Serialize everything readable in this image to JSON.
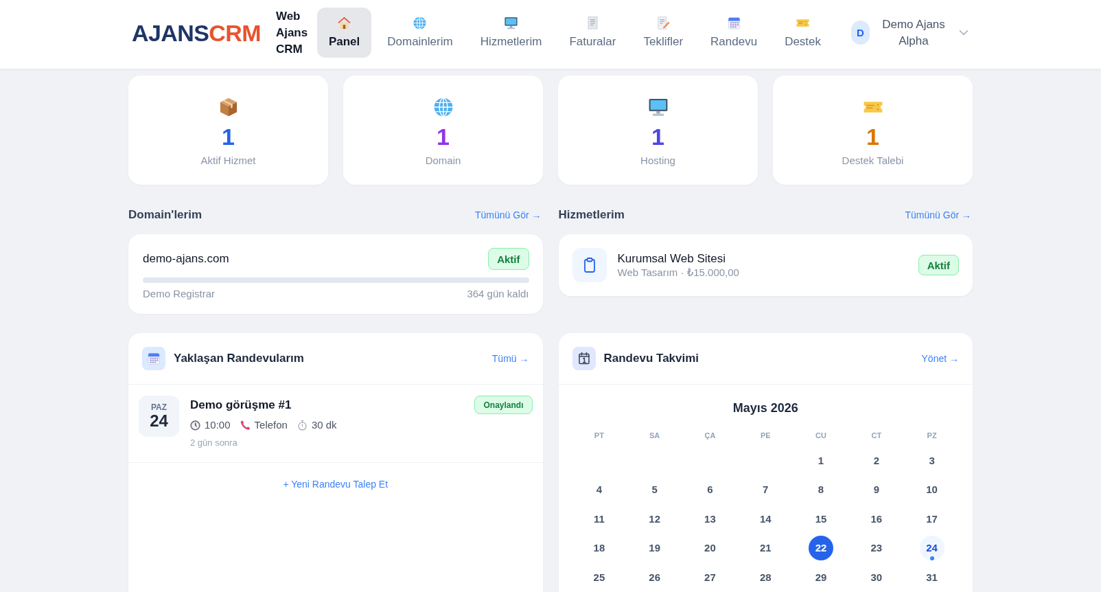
{
  "header": {
    "logo": {
      "brand": "AJANS",
      "product": "CRM"
    },
    "site_name": "Web Ajans CRM",
    "nav": [
      {
        "label": "Panel",
        "selected": true
      },
      {
        "label": "Domainlerim",
        "selected": false
      },
      {
        "label": "Hizmetlerim",
        "selected": false
      },
      {
        "label": "Faturalar",
        "selected": false
      },
      {
        "label": "Teklifler",
        "selected": false
      },
      {
        "label": "Randevu",
        "selected": false
      },
      {
        "label": "Destek",
        "selected": false
      }
    ],
    "user": {
      "initial": "D",
      "name": "Demo Ajans Alpha"
    }
  },
  "stats": [
    {
      "value": "1",
      "label": "Aktif Hizmet",
      "color": "#2563eb"
    },
    {
      "value": "1",
      "label": "Domain",
      "color": "#9333ea"
    },
    {
      "value": "1",
      "label": "Hosting",
      "color": "#4f46e5"
    },
    {
      "value": "1",
      "label": "Destek Talebi",
      "color": "#d97706"
    }
  ],
  "domains": {
    "title": "Domain'lerim",
    "link": "Tümünü Gör →",
    "items": [
      {
        "name": "demo-ajans.com",
        "status": "Aktif",
        "registrar": "Demo Registrar",
        "remaining": "364 gün kaldı"
      }
    ]
  },
  "services": {
    "title": "Hizmetlerim",
    "link": "Tümünü Gör →",
    "items": [
      {
        "name": "Kurumsal Web Sitesi",
        "detail": "Web Tasarım · ₺15.000,00",
        "status": "Aktif"
      }
    ]
  },
  "appointments": {
    "title": "Yaklaşan Randevularım",
    "link": "Tümü →",
    "items": [
      {
        "weekday": "PAZ",
        "day": "24",
        "title": "Demo görüşme #1",
        "time": "10:00",
        "channel": "Telefon",
        "duration": "30 dk",
        "relative": "2 gün sonra",
        "status": "Onaylandı"
      }
    ],
    "new_link": "+ Yeni Randevu Talep Et"
  },
  "calendar": {
    "title": "Randevu Takvimi",
    "link": "Yönet →",
    "month": "Mayıs 2026",
    "weekdays": [
      "PT",
      "SA",
      "ÇA",
      "PE",
      "CU",
      "CT",
      "PZ"
    ],
    "weeks": [
      [
        {
          "kind": "blank"
        },
        {
          "kind": "blank"
        },
        {
          "kind": "blank"
        },
        {
          "kind": "blank"
        },
        {
          "kind": "day",
          "day": "1",
          "selected": false,
          "has_event": false
        },
        {
          "kind": "day",
          "day": "2",
          "selected": false,
          "has_event": false
        },
        {
          "kind": "day",
          "day": "3",
          "selected": false,
          "has_event": false
        }
      ],
      [
        {
          "kind": "day",
          "day": "4",
          "selected": false,
          "has_event": false
        },
        {
          "kind": "day",
          "day": "5",
          "selected": false,
          "has_event": false
        },
        {
          "kind": "day",
          "day": "6",
          "selected": false,
          "has_event": false
        },
        {
          "kind": "day",
          "day": "7",
          "selected": false,
          "has_event": false
        },
        {
          "kind": "day",
          "day": "8",
          "selected": false,
          "has_event": false
        },
        {
          "kind": "day",
          "day": "9",
          "selected": false,
          "has_event": false
        },
        {
          "kind": "day",
          "day": "10",
          "selected": false,
          "has_event": false
        }
      ],
      [
        {
          "kind": "day",
          "day": "11",
          "selected": false,
          "has_event": false
        },
        {
          "kind": "day",
          "day": "12",
          "selected": false,
          "has_event": false
        },
        {
          "kind": "day",
          "day": "13",
          "selected": false,
          "has_event": false
        },
        {
          "kind": "day",
          "day": "14",
          "selected": false,
          "has_event": false
        },
        {
          "kind": "day",
          "day": "15",
          "selected": false,
          "has_event": false
        },
        {
          "kind": "day",
          "day": "16",
          "selected": false,
          "has_event": false
        },
        {
          "kind": "day",
          "day": "17",
          "selected": false,
          "has_event": false
        }
      ],
      [
        {
          "kind": "day",
          "day": "18",
          "selected": false,
          "has_event": false
        },
        {
          "kind": "day",
          "day": "19",
          "selected": false,
          "has_event": false
        },
        {
          "kind": "day",
          "day": "20",
          "selected": false,
          "has_event": false
        },
        {
          "kind": "day",
          "day": "21",
          "selected": false,
          "has_event": false
        },
        {
          "kind": "day",
          "day": "22",
          "selected": true,
          "has_event": false
        },
        {
          "kind": "day",
          "day": "23",
          "selected": false,
          "has_event": false
        },
        {
          "kind": "day",
          "day": "24",
          "selected": false,
          "has_event": true
        }
      ],
      [
        {
          "kind": "day",
          "day": "25",
          "selected": false,
          "has_event": false
        },
        {
          "kind": "day",
          "day": "26",
          "selected": false,
          "has_event": false
        },
        {
          "kind": "day",
          "day": "27",
          "selected": false,
          "has_event": false
        },
        {
          "kind": "day",
          "day": "28",
          "selected": false,
          "has_event": false
        },
        {
          "kind": "day",
          "day": "29",
          "selected": false,
          "has_event": false
        },
        {
          "kind": "day",
          "day": "30",
          "selected": false,
          "has_event": false
        },
        {
          "kind": "day",
          "day": "31",
          "selected": false,
          "has_event": false
        }
      ]
    ]
  }
}
